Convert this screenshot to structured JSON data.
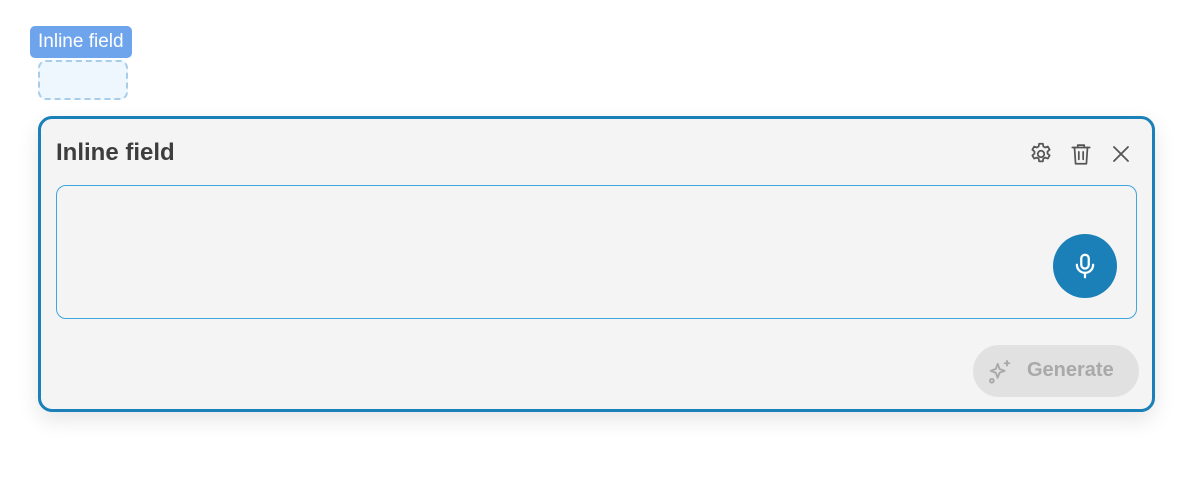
{
  "tag": {
    "label": "Inline field"
  },
  "panel": {
    "title": "Inline field",
    "icons": {
      "settings": "gear-icon",
      "delete": "trash-icon",
      "close": "close-icon",
      "mic": "microphone-icon",
      "generate": "sparkle-icon"
    },
    "input": {
      "value": "",
      "placeholder": ""
    },
    "generate_label": "Generate",
    "generate_disabled": true
  },
  "colors": {
    "accent": "#1b80b8",
    "tag_bg": "#6ea4ec",
    "panel_bg": "#f4f4f4",
    "input_border": "#3fa6dc",
    "disabled_bg": "#e1e1e1",
    "disabled_text": "#a9a9a9"
  }
}
